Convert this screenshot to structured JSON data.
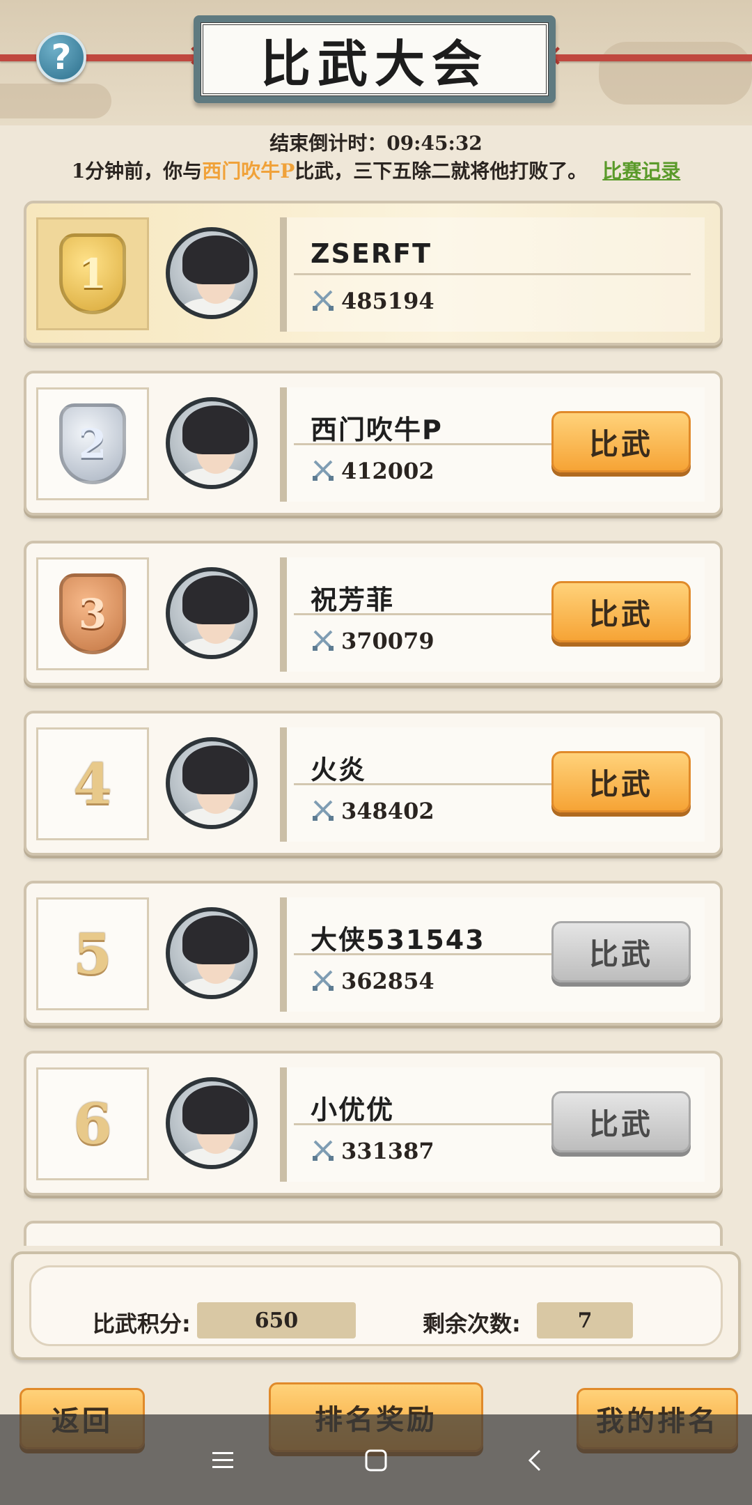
{
  "header": {
    "title": "比武大会",
    "help_icon": "question-mark-icon"
  },
  "status": {
    "countdown_label": "结束倒计时：",
    "countdown_value": "09:45:32",
    "msg_prefix": "1分钟前，你与",
    "msg_opponent": "西门吹牛P",
    "msg_suffix": "比武，三下五除二就将他打败了。",
    "record_link": "比赛记录"
  },
  "players": [
    {
      "rank": "1",
      "name": "ZSERFT",
      "power": "485194",
      "button": null
    },
    {
      "rank": "2",
      "name": "西门吹牛P",
      "power": "412002",
      "button": "比武",
      "enabled": true
    },
    {
      "rank": "3",
      "name": "祝芳菲",
      "power": "370079",
      "button": "比武",
      "enabled": true
    },
    {
      "rank": "4",
      "name": "火炎",
      "power": "348402",
      "button": "比武",
      "enabled": true
    },
    {
      "rank": "5",
      "name": "大侠531543",
      "power": "362854",
      "button": "比武",
      "enabled": false
    },
    {
      "rank": "6",
      "name": "小优优",
      "power": "331387",
      "button": "比武",
      "enabled": false
    }
  ],
  "stats": {
    "points_label": "比武积分:",
    "points_value": "650",
    "remaining_label": "剩余次数:",
    "remaining_value": "7"
  },
  "bottom": {
    "back": "返回",
    "rank_reward": "排名奖励",
    "my_rank": "我的排名"
  },
  "colors": {
    "accent_orange": "#f6a436",
    "highlight_text": "#f0a23a",
    "link_green": "#5a9a2a"
  }
}
